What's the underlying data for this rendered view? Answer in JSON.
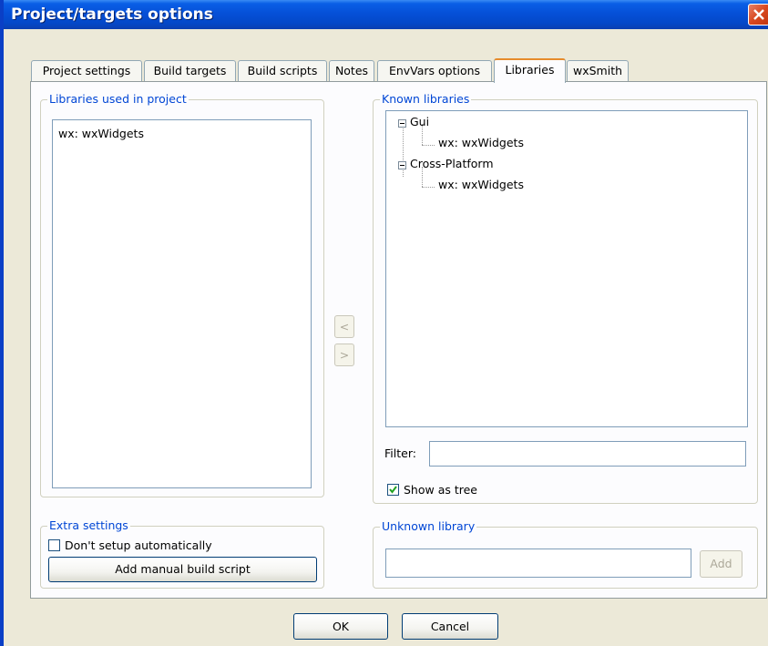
{
  "window": {
    "title": "Project/targets options"
  },
  "tabs": [
    {
      "label": "Project settings",
      "active": false
    },
    {
      "label": "Build targets",
      "active": false
    },
    {
      "label": "Build scripts",
      "active": false
    },
    {
      "label": "Notes",
      "active": false
    },
    {
      "label": "EnvVars options",
      "active": false
    },
    {
      "label": "Libraries",
      "active": true
    },
    {
      "label": "wxSmith",
      "active": false
    }
  ],
  "used_libraries": {
    "legend": "Libraries used in project",
    "items": [
      "wx: wxWidgets"
    ]
  },
  "transfer": {
    "add_label": "<",
    "remove_label": ">"
  },
  "known_libraries": {
    "legend": "Known libraries",
    "tree": [
      {
        "label": "Gui",
        "expanded": true,
        "children": [
          "wx: wxWidgets"
        ]
      },
      {
        "label": "Cross-Platform",
        "expanded": true,
        "children": [
          "wx: wxWidgets"
        ]
      }
    ],
    "filter_label": "Filter:",
    "filter_value": "",
    "show_as_tree_label": "Show as tree",
    "show_as_tree_checked": true
  },
  "extra_settings": {
    "legend": "Extra settings",
    "dont_setup_label": "Don't setup automatically",
    "dont_setup_checked": false,
    "add_script_label": "Add manual build script"
  },
  "unknown_library": {
    "legend": "Unknown library",
    "value": "",
    "add_label": "Add"
  },
  "dialog_buttons": {
    "ok": "OK",
    "cancel": "Cancel"
  },
  "colors": {
    "titlebar": "#0550d8",
    "legend_text": "#0046d5",
    "active_tab_accent": "#e68b2c",
    "close_button": "#d8481f"
  }
}
